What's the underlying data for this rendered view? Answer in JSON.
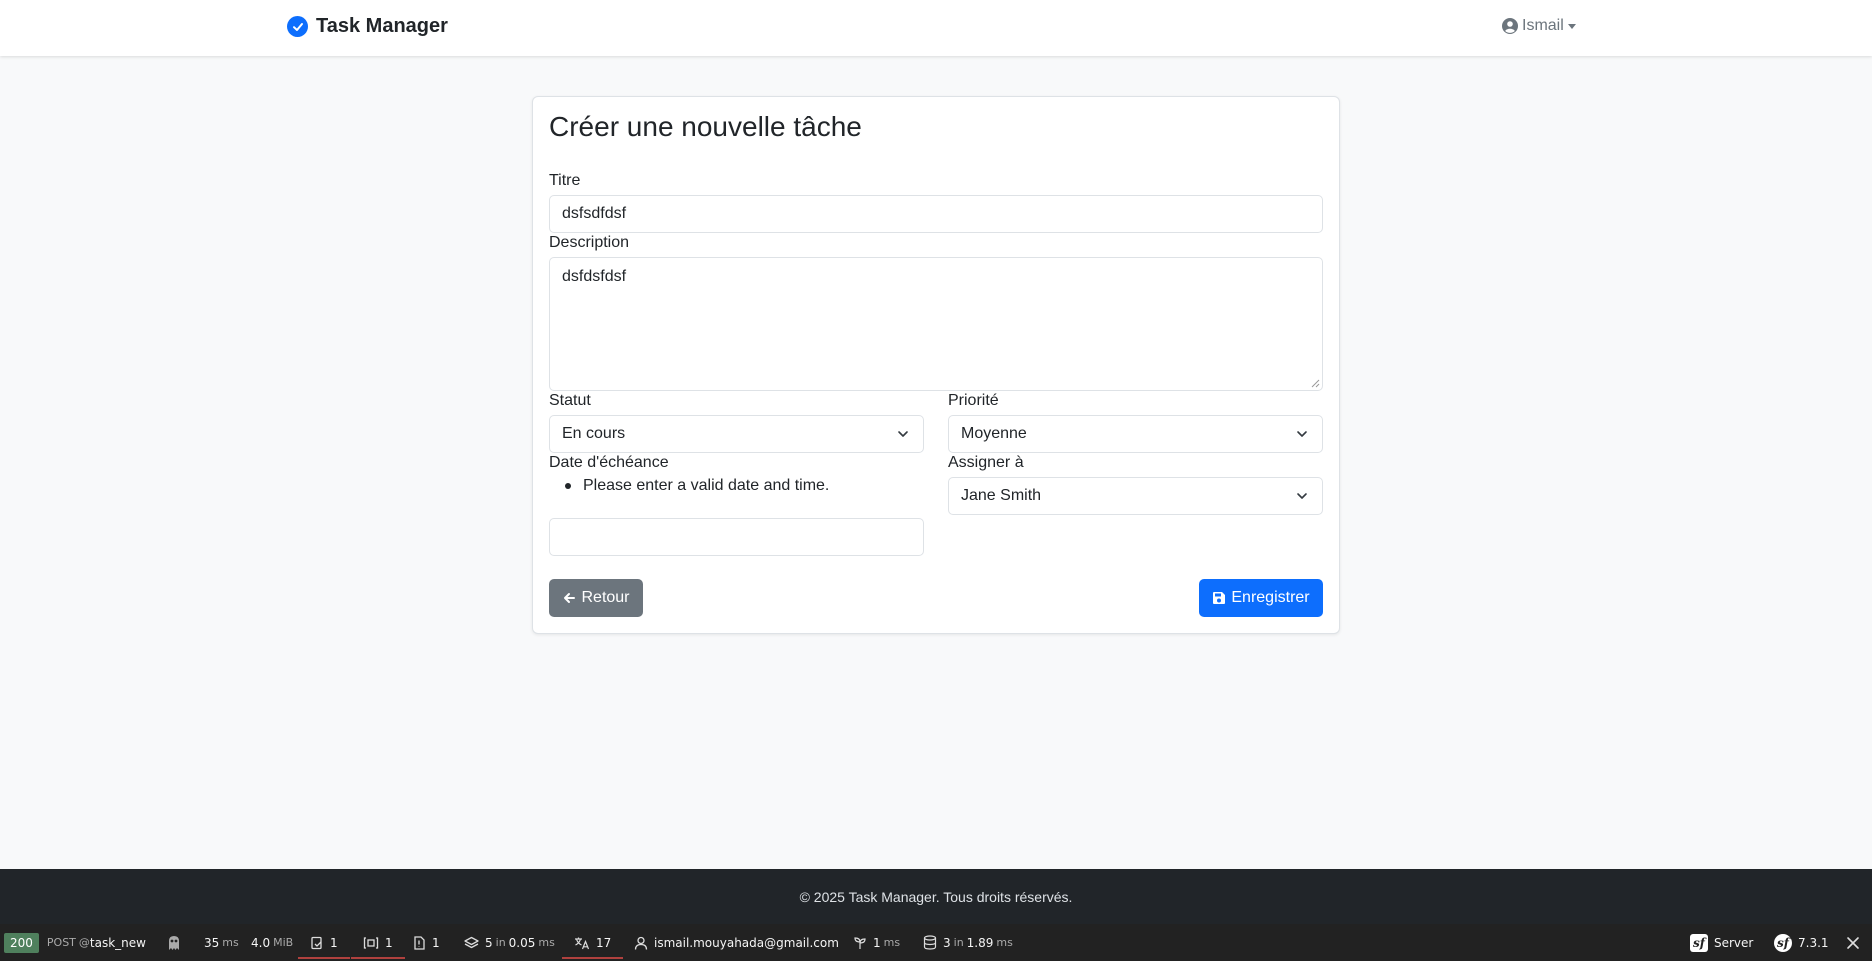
{
  "navbar": {
    "brand": "Task Manager",
    "user": "Ismail"
  },
  "form": {
    "title": "Créer une nouvelle tâche",
    "titre_label": "Titre",
    "titre_value": "dsfsdfdsf",
    "description_label": "Description",
    "description_value": "dsfdsfdsf",
    "statut_label": "Statut",
    "statut_value": "En cours",
    "priorite_label": "Priorité",
    "priorite_value": "Moyenne",
    "date_label": "Date d'échéance",
    "date_error": "Please enter a valid date and time.",
    "date_value": "",
    "assigner_label": "Assigner à",
    "assigner_value": "Jane Smith",
    "back_label": "Retour",
    "save_label": "Enregistrer"
  },
  "footer": {
    "text": "© 2025 Task Manager. Tous droits réservés."
  },
  "debug_toolbar": {
    "status_code": "200",
    "method": "POST",
    "route": "task_new",
    "time_value": "35",
    "time_unit": "ms",
    "memory_value": "4.0",
    "memory_unit": "MiB",
    "forms_count": "1",
    "validator_count": "1",
    "logs_count": "1",
    "events_count": "5",
    "events_in": "in",
    "events_time": "0.05",
    "events_unit": "ms",
    "translation_count": "17",
    "user_email": "ismail.mouyahada@gmail.com",
    "twig_count": "1",
    "twig_unit": "ms",
    "db_count": "3",
    "db_in": "in",
    "db_time": "1.89",
    "db_unit": "ms",
    "server_label": "Server",
    "symfony_version": "7.3.1",
    "status_color": "#4f805d",
    "error_underline_color": "#b0413e"
  },
  "colors": {
    "primary": "#0d6efd",
    "secondary": "#6c757d",
    "footer_bg": "#212529"
  }
}
